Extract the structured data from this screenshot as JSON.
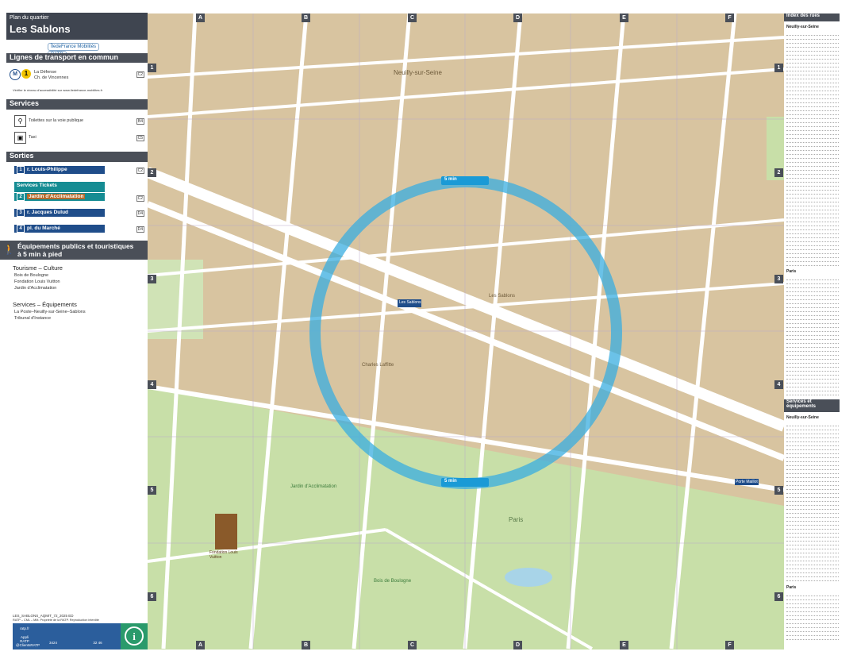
{
  "header": {
    "subtitle": "Plan du quartier",
    "title": "Les Sablons"
  },
  "logos": {
    "idf": "ÎledeFrance Mobilités",
    "ratp": "RATP"
  },
  "lines_section": {
    "title": "Lignes de transport en commun",
    "metro_line": "1",
    "destinations": [
      "La Défense",
      "Ch. de Vincennes"
    ],
    "note": "Vérifier le niveau d'accessibilité sur www.iledefrance-mobilites.fr",
    "ref": "C2"
  },
  "services_section": {
    "title": "Services",
    "items": [
      {
        "label": "Toilettes sur la voie publique",
        "icon": "toilets-icon",
        "ref": "B4"
      },
      {
        "label": "Taxi",
        "icon": "taxi-icon",
        "ref": "C5"
      }
    ]
  },
  "exits_section": {
    "title": "Sorties",
    "items": [
      {
        "num": "1",
        "label": "r. Louis-Philippe",
        "ref": "C2",
        "style": "blue"
      },
      {
        "num": "",
        "label": "Services   Tickets",
        "ref": "",
        "style": "teal"
      },
      {
        "num": "2",
        "label": "Jardin d'Acclimatation",
        "ref": "C2",
        "style": "teal"
      },
      {
        "num": "3",
        "label": "r. Jacques Dulud",
        "ref": "D4",
        "style": "blue"
      },
      {
        "num": "4",
        "label": "pl. du Marché",
        "ref": "D4",
        "style": "blue"
      }
    ]
  },
  "poi_section": {
    "title_line1": "Équipements publics et touristiques",
    "title_line2": "à 5 min à pied",
    "groups": [
      {
        "title": "Tourisme – Culture",
        "items": [
          "Bois de Boulogne",
          "Fondation Louis Vuitton",
          "Jardin d'Acclimatation"
        ]
      },
      {
        "title": "Services – Équipements",
        "items": [
          "La Poste–Neuilly-sur-Seine–Sablons",
          "Tribunal d'Instance"
        ]
      }
    ]
  },
  "footer": {
    "code": "LES_SABLONS_AQMIT_72_2025 ED",
    "credit": "RATP – CML – MM. Propriété de la RATP. Reproduction interdite",
    "contacts": [
      "ratp.fr",
      "Appli RATP",
      "3424",
      "@ClientsRATP",
      "32 46"
    ]
  },
  "map": {
    "col_labels": [
      "A",
      "B",
      "C",
      "D",
      "E",
      "F"
    ],
    "row_labels": [
      "1",
      "2",
      "3",
      "4",
      "5",
      "6"
    ],
    "place_labels": {
      "neuilly": "Neuilly-sur-Seine",
      "les_sablons": "Les Sablons",
      "charles_laffitte": "Charles Laffitte",
      "jardin": "Jardin d'Acclimatation",
      "paris": "Paris",
      "bois": "Bois de Boulogne",
      "fondation": "Fondation Louis Vuitton",
      "porte_maillot": "Porte Maillot",
      "station": "Les Sablons"
    },
    "walk_label": "5 min",
    "colors": {
      "park": "#c8dfa8",
      "block": "#d8c4a0",
      "road": "#ffffff",
      "circle": "#3aaee0",
      "water": "#a8d4e8"
    }
  },
  "index": {
    "title": "Index des rues",
    "neuilly_title": "Neuilly-sur-Seine",
    "paris_title": "Paris",
    "services_title": "Services et équipements",
    "services_neuilly": "Neuilly-sur-Seine",
    "services_paris": "Paris"
  }
}
